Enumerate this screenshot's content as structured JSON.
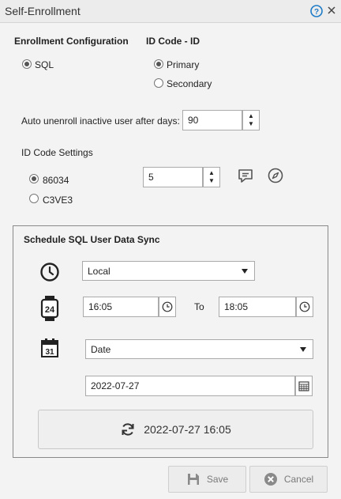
{
  "window": {
    "title": "Self-Enrollment",
    "help_icon": "help-circle-icon",
    "close_icon": "close-icon"
  },
  "enrollment": {
    "heading": "Enrollment Configuration",
    "options": [
      {
        "label": "SQL",
        "checked": true
      }
    ]
  },
  "id_code": {
    "heading": "ID Code - ID",
    "options": [
      {
        "label": "Primary",
        "checked": true
      },
      {
        "label": "Secondary",
        "checked": false
      }
    ]
  },
  "auto_unenroll": {
    "label": "Auto unenroll inactive user after days:",
    "value": "90"
  },
  "id_code_settings": {
    "heading": "ID Code Settings",
    "options": [
      {
        "label": "86034",
        "checked": true
      },
      {
        "label": "C3VE3",
        "checked": false
      }
    ],
    "count_value": "5",
    "comment_icon": "comment-icon",
    "compass_icon": "compass-icon"
  },
  "schedule": {
    "heading": "Schedule SQL User Data Sync",
    "timezone_icon": "clock-icon",
    "timezone_value": "Local",
    "hours_icon": "24-hour-watch-icon",
    "time_from": "16:05",
    "to_label": "To",
    "time_to": "18:05",
    "calendar_icon": "calendar-icon",
    "date_mode": "Date",
    "date_value": "2022-07-27",
    "sync_label": "2022-07-27 16:05",
    "sync_icon": "refresh-icon"
  },
  "footer": {
    "save_label": "Save",
    "cancel_label": "Cancel"
  },
  "colors": {
    "accent": "#1e7bc8",
    "background": "#f3f3f3",
    "disabled_text": "#7a7a7a"
  }
}
